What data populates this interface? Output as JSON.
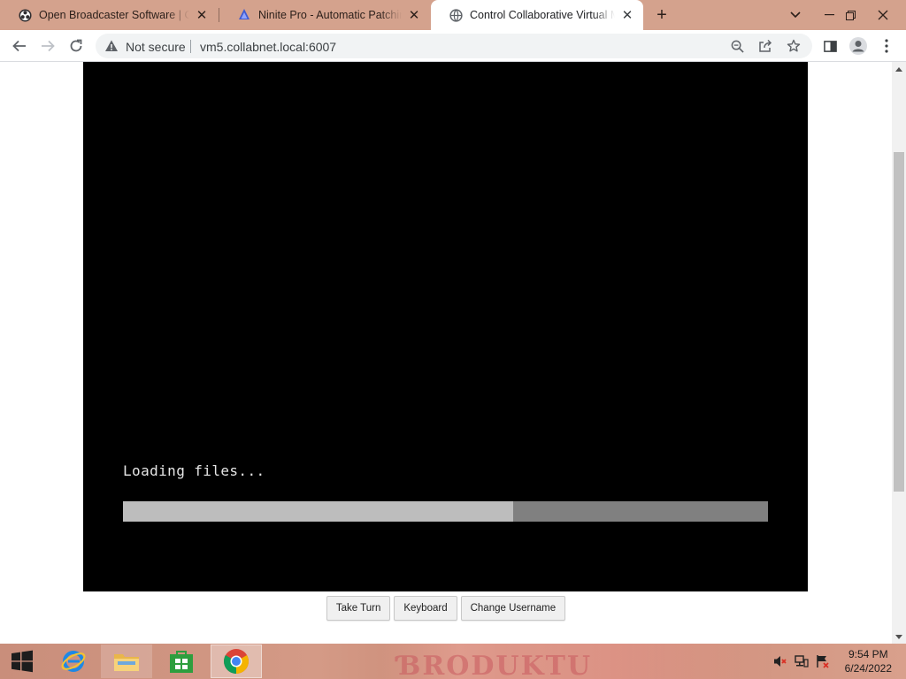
{
  "browser": {
    "tabs": [
      {
        "title": "Open Broadcaster Software | OBS",
        "icon": "obs-icon",
        "active": false
      },
      {
        "title": "Ninite Pro - Automatic Patching and",
        "icon": "ninite-icon",
        "active": false
      },
      {
        "title": "Control Collaborative Virtual Machine",
        "icon": "globe-icon",
        "active": true
      }
    ],
    "new_tab_label": "+",
    "security_text": "Not secure",
    "url": "vm5.collabnet.local:6007"
  },
  "vm": {
    "loading_text": "Loading files...",
    "progress_percent": 60.5,
    "colors": {
      "screen": "#000000",
      "progress_track": "#808080",
      "progress_fill": "#bdbdbd"
    }
  },
  "controls": {
    "take_turn": "Take Turn",
    "keyboard": "Keyboard",
    "change_username": "Change Username"
  },
  "taskbar": {
    "apps": [
      "windows-start-icon",
      "internet-explorer-icon",
      "file-explorer-icon",
      "store-icon",
      "chrome-icon"
    ],
    "time": "9:54 PM",
    "date": "6/24/2022"
  }
}
